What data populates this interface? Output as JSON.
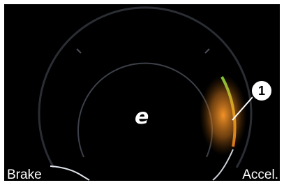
{
  "gauge": {
    "mode_symbol": "e",
    "left_label": "Brake",
    "right_label": "Accel.",
    "callout_number": "1",
    "accel_color_start": "#d7781c",
    "accel_color_end": "#7cc23a"
  }
}
